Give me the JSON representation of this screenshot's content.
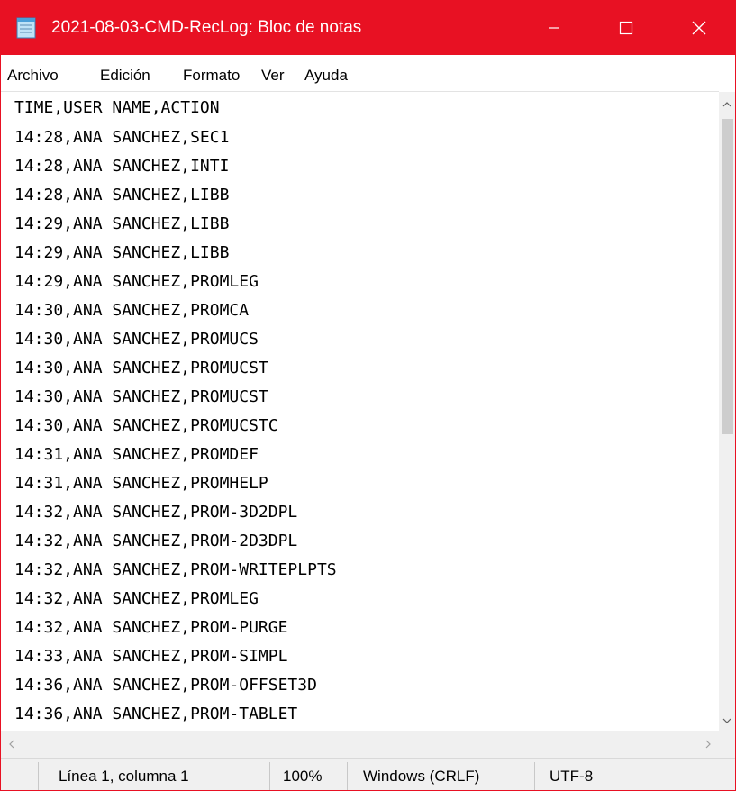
{
  "window": {
    "title": "2021-08-03-CMD-RecLog: Bloc de notas",
    "app_icon": "notepad-icon",
    "title_bar_color": "#e81123",
    "controls": {
      "minimize_icon": "minimize-icon",
      "maximize_icon": "maximize-icon",
      "close_icon": "close-icon"
    }
  },
  "menu": {
    "items": [
      "Archivo",
      "Edición",
      "Formato",
      "Ver",
      "Ayuda"
    ]
  },
  "editor": {
    "lines": [
      "TIME,USER NAME,ACTION",
      "14:28,ANA SANCHEZ,SEC1",
      "14:28,ANA SANCHEZ,INTI",
      "14:28,ANA SANCHEZ,LIBB",
      "14:29,ANA SANCHEZ,LIBB",
      "14:29,ANA SANCHEZ,LIBB",
      "14:29,ANA SANCHEZ,PROMLEG",
      "14:30,ANA SANCHEZ,PROMCA",
      "14:30,ANA SANCHEZ,PROMUCS",
      "14:30,ANA SANCHEZ,PROMUCST",
      "14:30,ANA SANCHEZ,PROMUCST",
      "14:30,ANA SANCHEZ,PROMUCSTC",
      "14:31,ANA SANCHEZ,PROMDEF",
      "14:31,ANA SANCHEZ,PROMHELP",
      "14:32,ANA SANCHEZ,PROM-3D2DPL",
      "14:32,ANA SANCHEZ,PROM-2D3DPL",
      "14:32,ANA SANCHEZ,PROM-WRITEPLPTS",
      "14:32,ANA SANCHEZ,PROMLEG",
      "14:32,ANA SANCHEZ,PROM-PURGE",
      "14:33,ANA SANCHEZ,PROM-SIMPL",
      "14:36,ANA SANCHEZ,PROM-OFFSET3D",
      "14:36,ANA SANCHEZ,PROM-TABLET"
    ],
    "vertical_scroll_position": 0.0
  },
  "status": {
    "position": "Línea 1, columna 1",
    "zoom": "100%",
    "line_ending": "Windows (CRLF)",
    "encoding": "UTF-8"
  }
}
